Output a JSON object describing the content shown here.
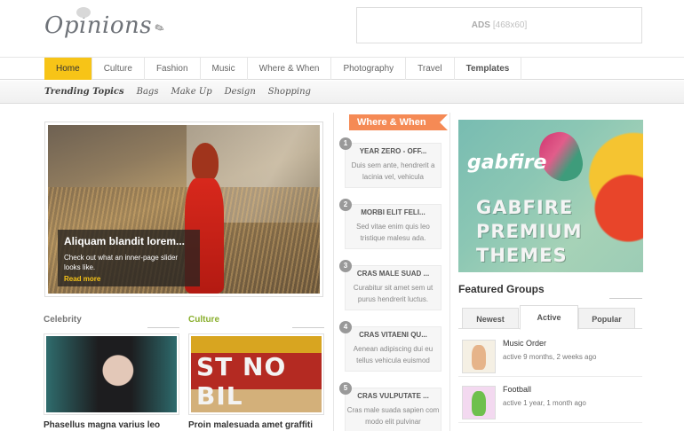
{
  "site": {
    "logo": "Opinions"
  },
  "ads": {
    "label": "ADS",
    "size": "[468x60]"
  },
  "nav": {
    "items": [
      "Home",
      "Culture",
      "Fashion",
      "Music",
      "Where & When",
      "Photography",
      "Travel",
      "Templates"
    ],
    "active": "Home"
  },
  "subnav": {
    "items": [
      "Trending Topics",
      "Bags",
      "Make Up",
      "Design",
      "Shopping"
    ]
  },
  "slider": {
    "title": "Aliquam blandit lorem...",
    "text": "Check out what an inner-page slider looks like.",
    "link": "Read more"
  },
  "categories": [
    {
      "heading": "Celebrity",
      "heading_color": "#777777",
      "title": "Phasellus magna varius leo"
    },
    {
      "heading": "Culture",
      "heading_color": "#8aaf2e",
      "title": "Proin malesuada amet graffiti",
      "image_text": "ST NO BIL"
    }
  ],
  "where_when": {
    "heading": "Where & When",
    "items": [
      {
        "num": "1",
        "title": "YEAR ZERO - OFF...",
        "text": "Duis sem ante, hendrerit a lacinia vel, vehicula"
      },
      {
        "num": "2",
        "title": "MORBI ELIT FELI...",
        "text": "Sed vitae enim quis leo tristique malesu ada."
      },
      {
        "num": "3",
        "title": "CRAS MALE SUAD ...",
        "text": "Curabitur sit amet sem ut purus hendrerit luctus."
      },
      {
        "num": "4",
        "title": "CRAS VITAENI QU...",
        "text": "Aenean adipiscing dui eu tellus vehicula euismod"
      },
      {
        "num": "5",
        "title": "CRAS VULPUTATE ...",
        "text": "Cras male suada sapien com modo elit pulvinar"
      }
    ]
  },
  "banner": {
    "brand": "gabfire",
    "line1": "GABFIRE",
    "line2": "PREMIUM",
    "line3": "THEMES"
  },
  "featured": {
    "title": "Featured Groups",
    "tabs": [
      "Newest",
      "Active",
      "Popular"
    ],
    "active_tab": "Active",
    "groups": [
      {
        "name": "Music Order",
        "meta": "active 9 months, 2 weeks ago",
        "avatar_color": "#e6b48a"
      },
      {
        "name": "Football",
        "meta": "active 1 year, 1 month ago",
        "avatar_color": "#6ec04d"
      }
    ]
  },
  "colors": {
    "accent": "#f7c417",
    "ribbon": "#f58a55",
    "culture": "#8aaf2e"
  }
}
